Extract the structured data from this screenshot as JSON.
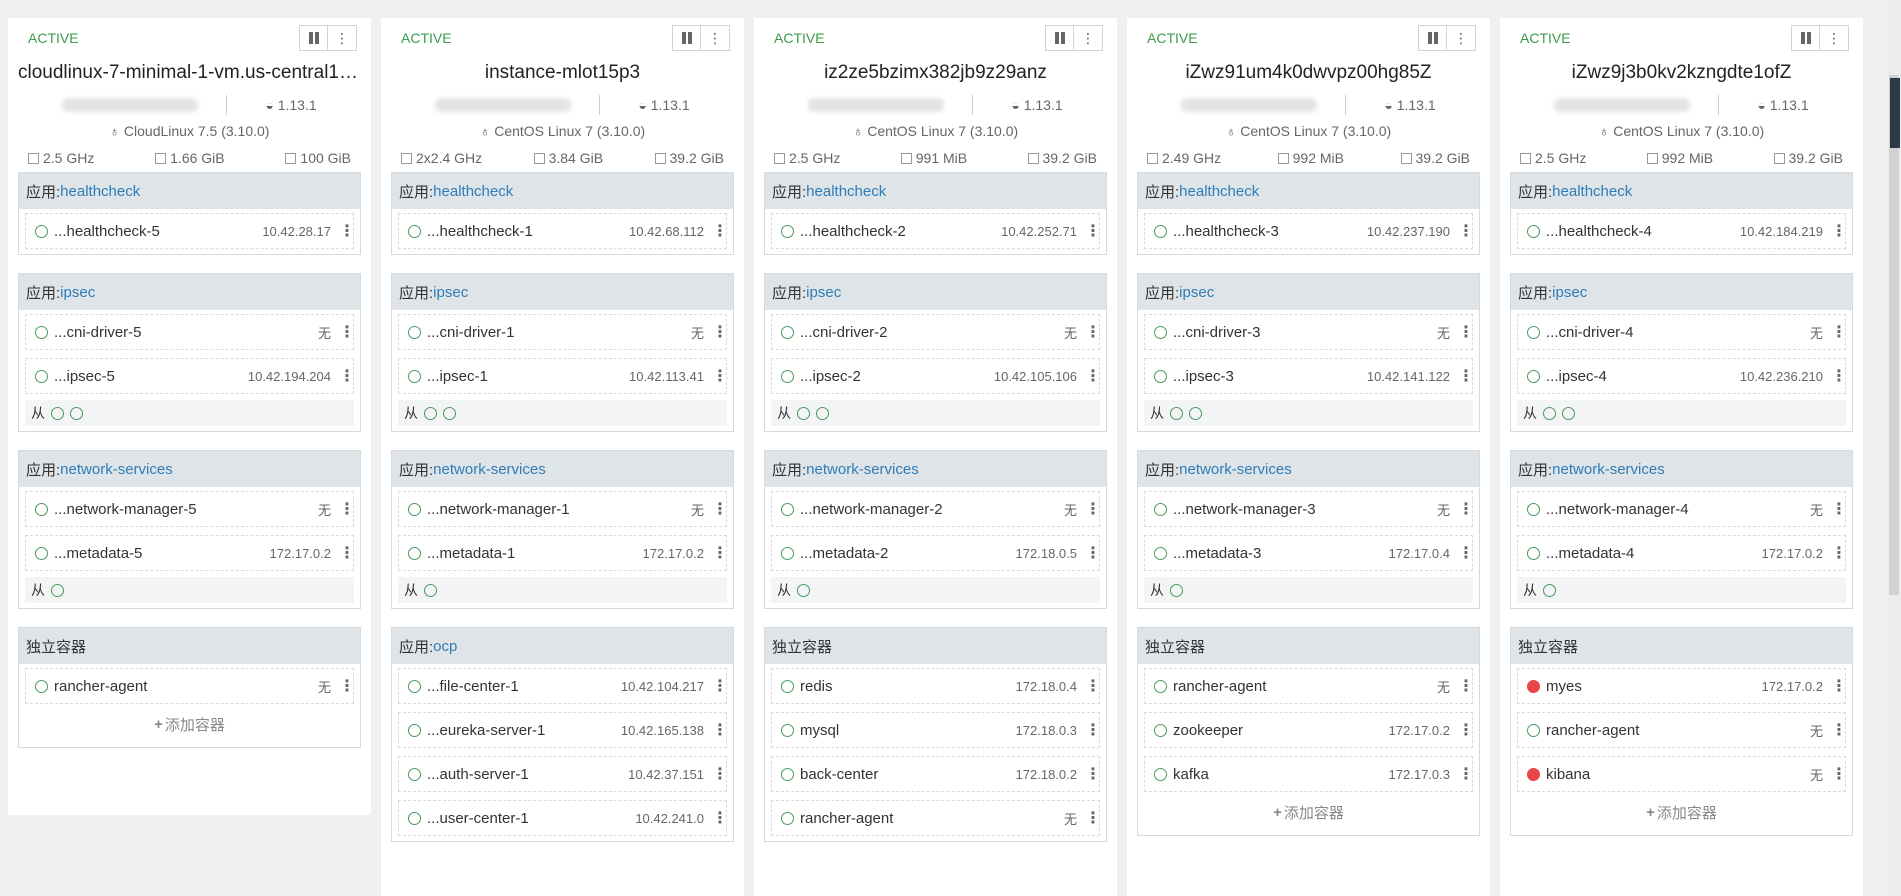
{
  "labels": {
    "app_prefix": "应用: ",
    "standalone": "独立容器",
    "sidekick": "从",
    "add_container": "添加容器",
    "none": "无"
  },
  "hosts": [
    {
      "state": "ACTIVE",
      "name": "cloudlinux-7-minimal-1-vm.us-central1-...",
      "docker": "1.13.1",
      "os": "CloudLinux 7.5 (3.10.0)",
      "cpu": "2.5 GHz",
      "mem": "1.66 GiB",
      "disk": "100 GiB",
      "stacks": [
        {
          "app": "healthcheck",
          "containers": [
            {
              "name": "...healthcheck-5",
              "ip": "10.42.28.17",
              "status": "ok"
            }
          ],
          "sidekicks": 0
        },
        {
          "app": "ipsec",
          "containers": [
            {
              "name": "...cni-driver-5",
              "ip": "无",
              "status": "ok"
            },
            {
              "name": "...ipsec-5",
              "ip": "10.42.194.204",
              "status": "ok"
            }
          ],
          "sidekicks": 2
        },
        {
          "app": "network-services",
          "containers": [
            {
              "name": "...network-manager-5",
              "ip": "无",
              "status": "ok"
            },
            {
              "name": "...metadata-5",
              "ip": "172.17.0.2",
              "status": "ok"
            }
          ],
          "sidekicks": 1
        }
      ],
      "standalone": {
        "title": "独立容器",
        "containers": [
          {
            "name": "rancher-agent",
            "ip": "无",
            "status": "ok"
          }
        ],
        "add": true
      }
    },
    {
      "state": "ACTIVE",
      "name": "instance-mlot15p3",
      "docker": "1.13.1",
      "os": "CentOS Linux 7 (3.10.0)",
      "cpu": "2x2.4 GHz",
      "mem": "3.84 GiB",
      "disk": "39.2 GiB",
      "stacks": [
        {
          "app": "healthcheck",
          "containers": [
            {
              "name": "...healthcheck-1",
              "ip": "10.42.68.112",
              "status": "ok"
            }
          ],
          "sidekicks": 0
        },
        {
          "app": "ipsec",
          "containers": [
            {
              "name": "...cni-driver-1",
              "ip": "无",
              "status": "ok"
            },
            {
              "name": "...ipsec-1",
              "ip": "10.42.113.41",
              "status": "ok"
            }
          ],
          "sidekicks": 2
        },
        {
          "app": "network-services",
          "containers": [
            {
              "name": "...network-manager-1",
              "ip": "无",
              "status": "ok"
            },
            {
              "name": "...metadata-1",
              "ip": "172.17.0.2",
              "status": "ok"
            }
          ],
          "sidekicks": 1
        }
      ],
      "standalone": {
        "app": "ocp",
        "containers": [
          {
            "name": "...file-center-1",
            "ip": "10.42.104.217",
            "status": "ok"
          },
          {
            "name": "...eureka-server-1",
            "ip": "10.42.165.138",
            "status": "ok"
          },
          {
            "name": "...auth-server-1",
            "ip": "10.42.37.151",
            "status": "ok"
          },
          {
            "name": "...user-center-1",
            "ip": "10.42.241.0",
            "status": "ok"
          }
        ],
        "add": false
      }
    },
    {
      "state": "ACTIVE",
      "name": "iz2ze5bzimx382jb9z29anz",
      "docker": "1.13.1",
      "os": "CentOS Linux 7 (3.10.0)",
      "cpu": "2.5 GHz",
      "mem": "991 MiB",
      "disk": "39.2 GiB",
      "stacks": [
        {
          "app": "healthcheck",
          "containers": [
            {
              "name": "...healthcheck-2",
              "ip": "10.42.252.71",
              "status": "ok"
            }
          ],
          "sidekicks": 0
        },
        {
          "app": "ipsec",
          "containers": [
            {
              "name": "...cni-driver-2",
              "ip": "无",
              "status": "ok"
            },
            {
              "name": "...ipsec-2",
              "ip": "10.42.105.106",
              "status": "ok"
            }
          ],
          "sidekicks": 2
        },
        {
          "app": "network-services",
          "containers": [
            {
              "name": "...network-manager-2",
              "ip": "无",
              "status": "ok"
            },
            {
              "name": "...metadata-2",
              "ip": "172.18.0.5",
              "status": "ok"
            }
          ],
          "sidekicks": 1
        }
      ],
      "standalone": {
        "title": "独立容器",
        "containers": [
          {
            "name": "redis",
            "ip": "172.18.0.4",
            "status": "ok"
          },
          {
            "name": "mysql",
            "ip": "172.18.0.3",
            "status": "ok"
          },
          {
            "name": "back-center",
            "ip": "172.18.0.2",
            "status": "ok"
          },
          {
            "name": "rancher-agent",
            "ip": "无",
            "status": "ok"
          }
        ],
        "add": false
      }
    },
    {
      "state": "ACTIVE",
      "name": "iZwz91um4k0dwvpz00hg85Z",
      "docker": "1.13.1",
      "os": "CentOS Linux 7 (3.10.0)",
      "cpu": "2.49 GHz",
      "mem": "992 MiB",
      "disk": "39.2 GiB",
      "stacks": [
        {
          "app": "healthcheck",
          "containers": [
            {
              "name": "...healthcheck-3",
              "ip": "10.42.237.190",
              "status": "ok"
            }
          ],
          "sidekicks": 0
        },
        {
          "app": "ipsec",
          "containers": [
            {
              "name": "...cni-driver-3",
              "ip": "无",
              "status": "ok"
            },
            {
              "name": "...ipsec-3",
              "ip": "10.42.141.122",
              "status": "ok"
            }
          ],
          "sidekicks": 2
        },
        {
          "app": "network-services",
          "containers": [
            {
              "name": "...network-manager-3",
              "ip": "无",
              "status": "ok"
            },
            {
              "name": "...metadata-3",
              "ip": "172.17.0.4",
              "status": "ok"
            }
          ],
          "sidekicks": 1
        }
      ],
      "standalone": {
        "title": "独立容器",
        "containers": [
          {
            "name": "rancher-agent",
            "ip": "无",
            "status": "ok"
          },
          {
            "name": "zookeeper",
            "ip": "172.17.0.2",
            "status": "ok"
          },
          {
            "name": "kafka",
            "ip": "172.17.0.3",
            "status": "ok"
          }
        ],
        "add": true
      }
    },
    {
      "state": "ACTIVE",
      "name": "iZwz9j3b0kv2kzngdte1ofZ",
      "docker": "1.13.1",
      "os": "CentOS Linux 7 (3.10.0)",
      "cpu": "2.5 GHz",
      "mem": "992 MiB",
      "disk": "39.2 GiB",
      "stacks": [
        {
          "app": "healthcheck",
          "containers": [
            {
              "name": "...healthcheck-4",
              "ip": "10.42.184.219",
              "status": "ok"
            }
          ],
          "sidekicks": 0
        },
        {
          "app": "ipsec",
          "containers": [
            {
              "name": "...cni-driver-4",
              "ip": "无",
              "status": "ok"
            },
            {
              "name": "...ipsec-4",
              "ip": "10.42.236.210",
              "status": "ok"
            }
          ],
          "sidekicks": 2
        },
        {
          "app": "network-services",
          "containers": [
            {
              "name": "...network-manager-4",
              "ip": "无",
              "status": "ok"
            },
            {
              "name": "...metadata-4",
              "ip": "172.17.0.2",
              "status": "ok"
            }
          ],
          "sidekicks": 1
        }
      ],
      "standalone": {
        "title": "独立容器",
        "containers": [
          {
            "name": "myes",
            "ip": "172.17.0.2",
            "status": "error"
          },
          {
            "name": "rancher-agent",
            "ip": "无",
            "status": "ok"
          },
          {
            "name": "kibana",
            "ip": "无",
            "status": "error"
          }
        ],
        "add": true
      }
    }
  ]
}
